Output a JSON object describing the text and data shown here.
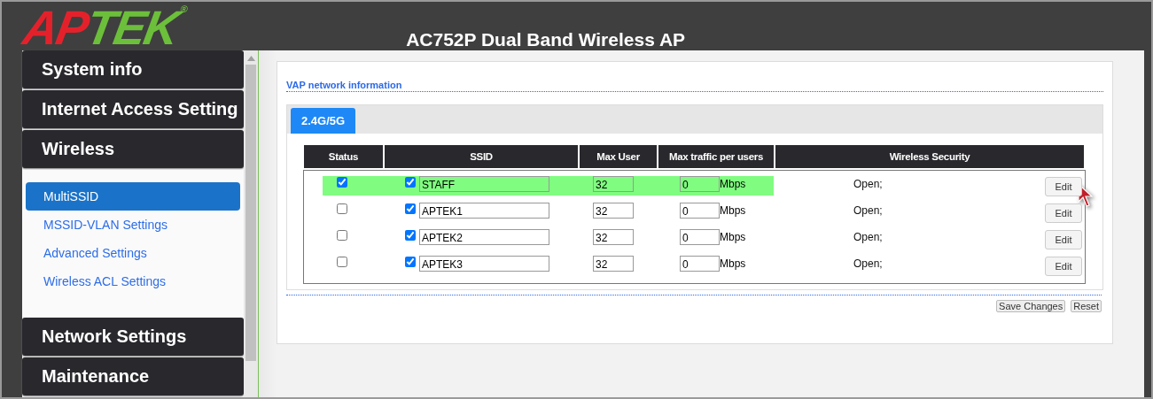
{
  "logo": {
    "part_1": "AP",
    "part_2": "TEK",
    "mark": "®"
  },
  "window": {
    "title": "AC752P Dual Band Wireless AP"
  },
  "sidebar": {
    "items": [
      {
        "label": "System info"
      },
      {
        "label": "Internet Access Setting"
      },
      {
        "label": "Wireless",
        "children": [
          {
            "label": "MultiSSID",
            "selected": true
          },
          {
            "label": "MSSID-VLAN Settings",
            "selected": false
          },
          {
            "label": "Advanced Settings",
            "selected": false
          },
          {
            "label": "Wireless ACL Settings",
            "selected": false
          }
        ]
      },
      {
        "label": "Network Settings"
      },
      {
        "label": "Maintenance"
      }
    ]
  },
  "section_title": "VAP network information",
  "tabs": [
    {
      "label": "2.4G/5G",
      "selected": true
    }
  ],
  "table": {
    "columns": [
      "Status",
      "SSID",
      "Max User",
      "Max traffic per users",
      "Wireless Security"
    ],
    "rows": [
      {
        "selected": true,
        "status": true,
        "ssid_enabled": true,
        "ssid": "STAFF",
        "max_user": "32",
        "max_traffic": "0",
        "unit": "Mbps",
        "security": "Open;",
        "action": "Edit"
      },
      {
        "selected": false,
        "status": false,
        "ssid_enabled": true,
        "ssid": "APTEK1",
        "max_user": "32",
        "max_traffic": "0",
        "unit": "Mbps",
        "security": "Open;",
        "action": "Edit"
      },
      {
        "selected": false,
        "status": false,
        "ssid_enabled": true,
        "ssid": "APTEK2",
        "max_user": "32",
        "max_traffic": "0",
        "unit": "Mbps",
        "security": "Open;",
        "action": "Edit"
      },
      {
        "selected": false,
        "status": false,
        "ssid_enabled": true,
        "ssid": "APTEK3",
        "max_user": "32",
        "max_traffic": "0",
        "unit": "Mbps",
        "security": "Open;",
        "action": "Edit"
      }
    ]
  },
  "buttons": [
    "Save Changes",
    "Reset"
  ]
}
